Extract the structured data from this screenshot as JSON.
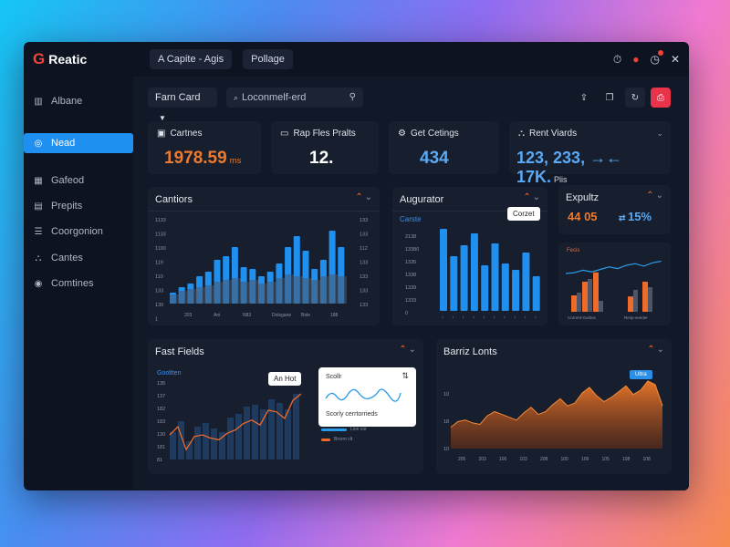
{
  "app": {
    "title": "Reatic",
    "logo_letter": "G"
  },
  "topbar": {
    "tabs": [
      {
        "label": "A Capite - Agis"
      },
      {
        "label": "Pollage"
      }
    ],
    "icons": [
      "timer-icon",
      "tag-icon",
      "clock-icon",
      "close-icon"
    ]
  },
  "sidebar": {
    "items": [
      {
        "label": "Albane",
        "icon": "building-icon",
        "active": false
      },
      {
        "label": "Nead",
        "icon": "settings-icon",
        "active": true
      },
      {
        "label": "Gafeod",
        "icon": "grid-icon",
        "active": false
      },
      {
        "label": "Prepits",
        "icon": "document-icon",
        "active": false
      },
      {
        "label": "Coorgonion",
        "icon": "list-icon",
        "active": false
      },
      {
        "label": "Cantes",
        "icon": "chart-icon",
        "active": false
      },
      {
        "label": "Comtines",
        "icon": "circle-icon",
        "active": false
      }
    ]
  },
  "controls": {
    "dropdown_label": "Farn Card",
    "search_value": "Loconmelf-erd",
    "buttons": [
      "export-icon",
      "copy-icon",
      "refresh-icon",
      "print-icon"
    ]
  },
  "stats": [
    {
      "label": "Cartnes",
      "value": "1978.59",
      "unit": "rns",
      "color": "#f07a2a",
      "icon": "cards-icon"
    },
    {
      "label": "Rap Fles Pralts",
      "value": "12.",
      "unit": "",
      "color": "#ffffff",
      "icon": "folder-icon"
    },
    {
      "label": "Get Cetings",
      "value": "434",
      "unit": "",
      "color": "#5aa9f5",
      "icon": "gear-icon"
    },
    {
      "label": "Rent Viards",
      "value": "123, 233, →← 17K.",
      "unit": "Plis",
      "color": "#5aa9f5",
      "icon": "chart-icon"
    }
  ],
  "palette": {
    "blue": "#1f8ff0",
    "orange": "#f06a2a",
    "panel": "#171f2e",
    "grey_bar": "#4d5566"
  },
  "panels": {
    "cantiors": {
      "title": "Cantiors",
      "left_ticks": [
        "1133",
        "1133",
        "1100",
        "119",
        "110",
        "133",
        "130",
        "1"
      ],
      "right_ticks": [
        "133",
        "133",
        "112",
        "133",
        "133",
        "133",
        "133"
      ],
      "x_labels": [
        "203",
        "Ani",
        "N83",
        "Dolsgane",
        "Bole",
        "188"
      ]
    },
    "augurator": {
      "title": "Augurator",
      "sublabel": "Carste",
      "badge": "Corzet",
      "ticks": [
        "2138",
        "13380",
        "1335",
        "1338",
        "1339",
        "1333",
        "0"
      ]
    },
    "expultz": {
      "title": "Expultz",
      "value_orange": "44 05",
      "value_blue": "15%",
      "chart_label": "Fecis",
      "x_labels": [
        "Corrent-Guittos",
        "Resp-seeder"
      ]
    },
    "fast_fields": {
      "title": "Fast Fields",
      "sublabel": "Gooltten",
      "badge": "An Hot",
      "ticks": [
        "135",
        "137",
        "182",
        "183",
        "130",
        "181",
        "81"
      ],
      "mini": {
        "title": "Scollr",
        "caption": "Scorly cerrtorrieds",
        "legend": [
          "Lion cor",
          "Brorrn clt"
        ]
      }
    },
    "barriz": {
      "title": "Barriz Lonts",
      "badge": "Ultra",
      "ticks": [
        "10",
        "18",
        "10"
      ],
      "x_labels": [
        "205",
        "203",
        "100",
        "103",
        "208",
        "100",
        "109",
        "105",
        "108",
        "108"
      ]
    }
  },
  "chart_data": [
    {
      "type": "bar",
      "title": "Cantiors",
      "series": [
        {
          "values": [
            12,
            18,
            22,
            30,
            35,
            48,
            52,
            62,
            40,
            38,
            30,
            35,
            44,
            62,
            74,
            58,
            38,
            48,
            80,
            62
          ]
        },
        {
          "values": [
            10,
            14,
            16,
            18,
            20,
            24,
            26,
            28,
            24,
            26,
            22,
            24,
            28,
            32,
            30,
            28,
            26,
            30,
            32,
            30
          ]
        }
      ]
    },
    {
      "type": "bar",
      "title": "Augurator",
      "series": [
        {
          "values": [
            90,
            60,
            72,
            85,
            50,
            74,
            52,
            45,
            64,
            38
          ]
        }
      ]
    },
    {
      "type": "bar",
      "title": "Expultz",
      "series": [
        {
          "values": [
            30,
            55,
            72,
            28,
            55
          ]
        },
        {
          "values": [
            35,
            60,
            20,
            40,
            45
          ]
        }
      ],
      "line": [
        40,
        42,
        48,
        44,
        50,
        56,
        52,
        60,
        64,
        58,
        66,
        70
      ]
    },
    {
      "type": "bar",
      "title": "Fast Fields",
      "series": [
        {
          "values": [
            30,
            42,
            20,
            36,
            40,
            34,
            30,
            46,
            50,
            58,
            60,
            55,
            66,
            62,
            55,
            72
          ]
        }
      ],
      "line": [
        30,
        40,
        12,
        28,
        30,
        26,
        24,
        32,
        36,
        44,
        48,
        42,
        60,
        58,
        50,
        72,
        80
      ]
    },
    {
      "type": "area",
      "title": "Barriz Lonts",
      "values": [
        30,
        38,
        40,
        36,
        34,
        46,
        52,
        48,
        44,
        40,
        50,
        58,
        48,
        52,
        62,
        70,
        60,
        64,
        78,
        86,
        74,
        66,
        72,
        80,
        88,
        76,
        82,
        95,
        90,
        60
      ]
    }
  ]
}
